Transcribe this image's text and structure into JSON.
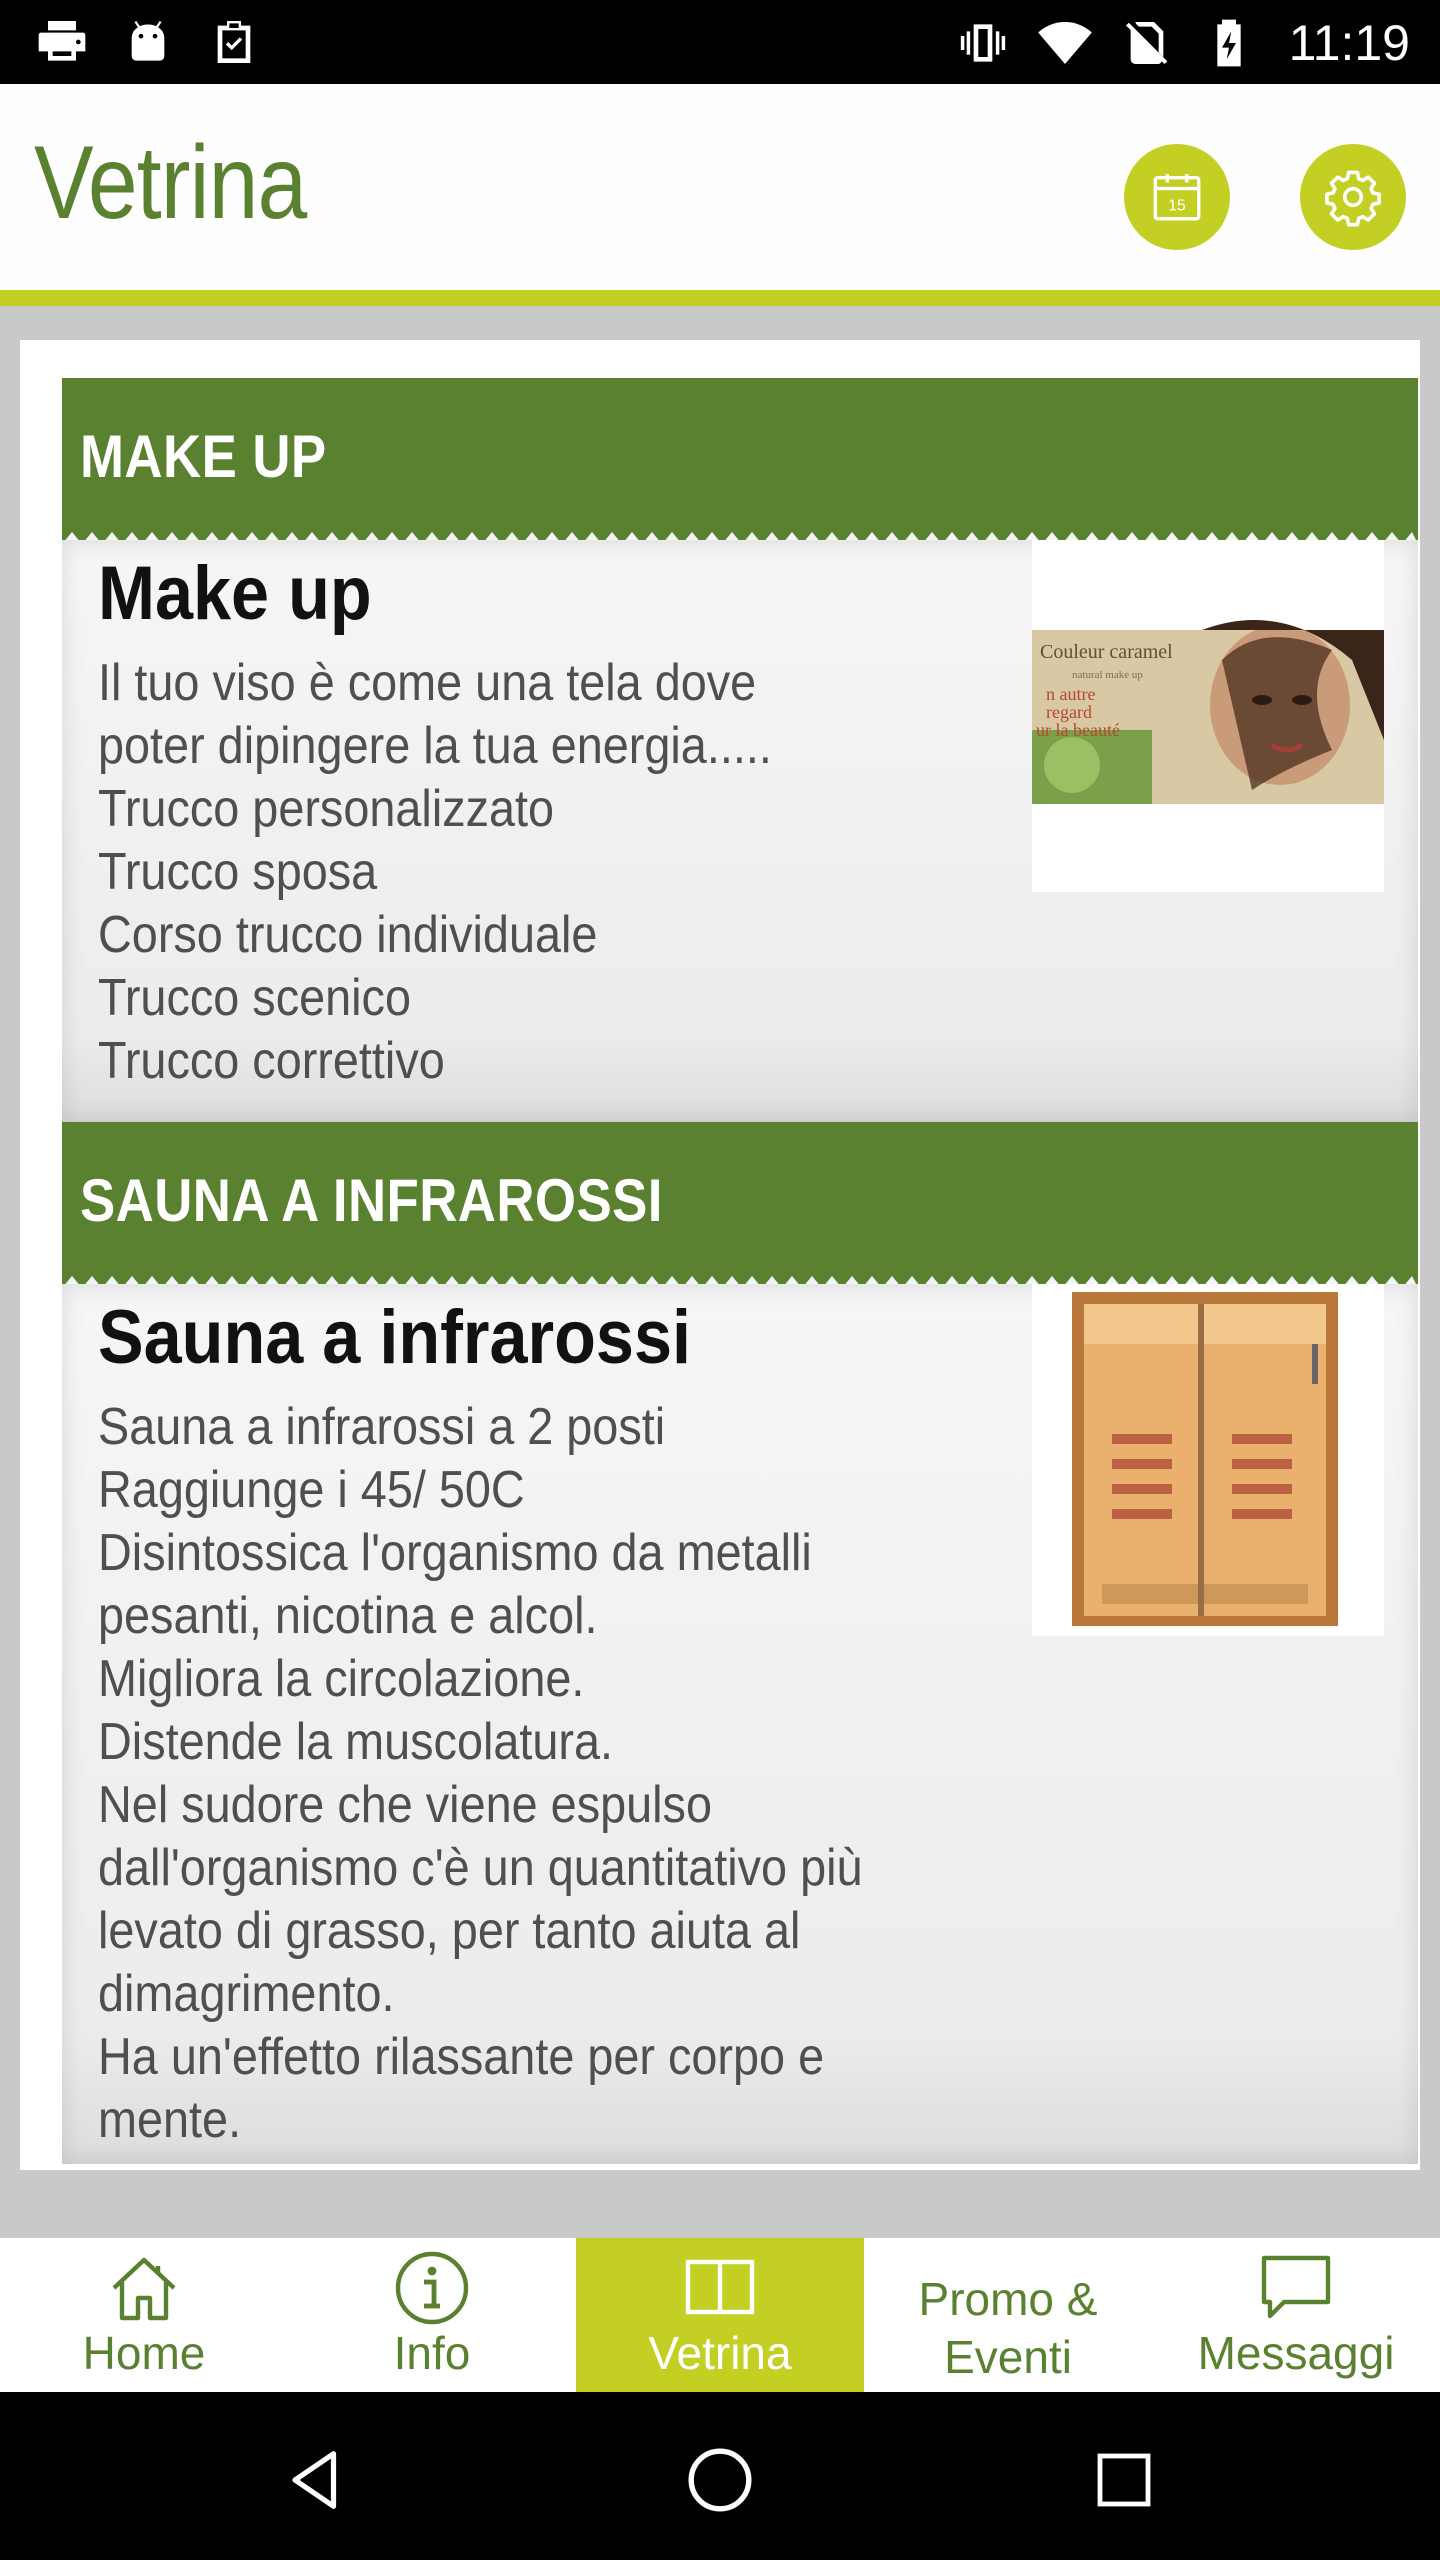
{
  "status_bar": {
    "time": "11:19",
    "left_icons": [
      "printer-icon",
      "android-icon",
      "clipboard-check-icon"
    ],
    "right_icons": [
      "vibrate-icon",
      "wifi-icon",
      "no-sim-icon",
      "battery-charging-icon"
    ]
  },
  "header": {
    "title": "Vetrina",
    "calendar_day": "15",
    "accent_color": "#c3cf23",
    "brand_color": "#5a8130"
  },
  "sections": [
    {
      "heading": "MAKE UP",
      "title": "Make up",
      "lines": [
        "Il tuo viso è come  una tela dove",
        "poter dipingere la tua energia.....",
        "Trucco personalizzato",
        "Trucco sposa",
        "Corso trucco individuale",
        "Trucco scenico",
        "Trucco correttivo"
      ],
      "image_text": [
        "Couleur caramel",
        "natural make up",
        "n autre",
        "regard",
        "ur la beauté"
      ]
    },
    {
      "heading": "SAUNA A INFRAROSSI",
      "title": "Sauna a infrarossi",
      "lines": [
        "Sauna a infrarossi a 2 posti",
        "Raggiunge i 45/ 50C",
        "Disintossica l'organismo da metalli",
        "pesanti, nicotina e alcol.",
        "Migliora la circolazione.",
        "Distende la muscolatura.",
        "Nel sudore che viene espulso",
        "dall'organismo c'è un quantitativo più",
        "levato di grasso, per tanto aiuta al",
        "dimagrimento.",
        "Ha un'effetto rilassante per corpo e",
        "mente."
      ]
    }
  ],
  "tabs": [
    {
      "label": "Home",
      "icon": "home-icon"
    },
    {
      "label": "Info",
      "icon": "info-icon"
    },
    {
      "label": "Vetrina",
      "icon": "book-icon",
      "active": true
    },
    {
      "label": "Promo &\nEventi"
    },
    {
      "label": "Messaggi",
      "icon": "message-icon"
    }
  ],
  "nav_bar": [
    "back-icon",
    "home-circle-icon",
    "recents-icon"
  ]
}
